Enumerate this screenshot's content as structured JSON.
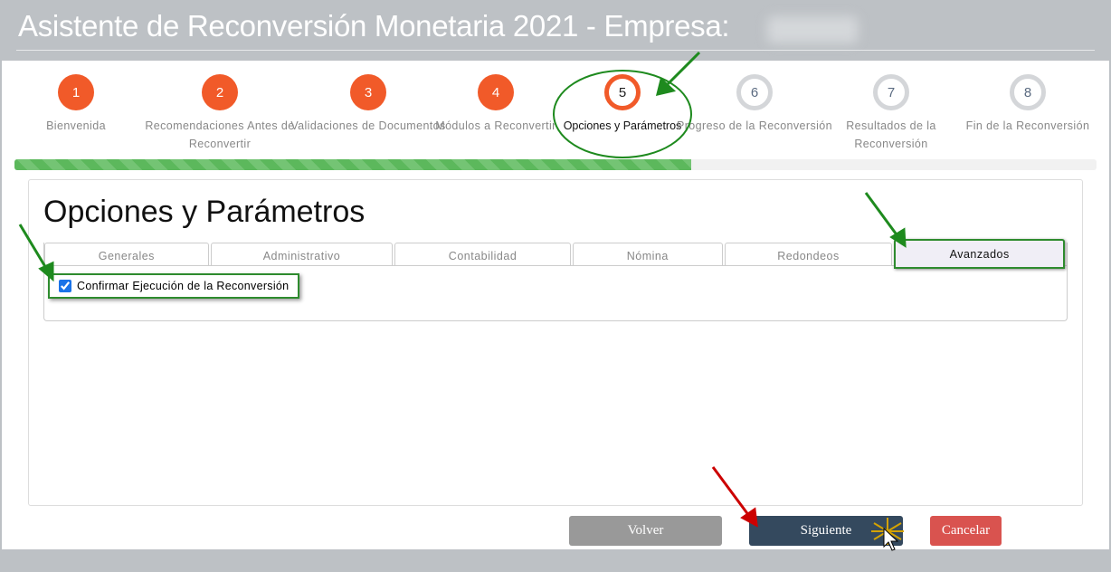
{
  "header": {
    "title": "Asistente de Reconversión Monetaria 2021 - Empresa:"
  },
  "steps": [
    {
      "num": "1",
      "label": "Bienvenida",
      "state": "done"
    },
    {
      "num": "2",
      "label": "Recomendaciones Antes de Reconvertir",
      "state": "done"
    },
    {
      "num": "3",
      "label": "Validaciones de Documentos",
      "state": "done"
    },
    {
      "num": "4",
      "label": "Módulos a Reconvertir",
      "state": "done"
    },
    {
      "num": "5",
      "label": "Opciones y Parámetros",
      "state": "current"
    },
    {
      "num": "6",
      "label": "Progreso de la Reconversión",
      "state": "pending"
    },
    {
      "num": "7",
      "label": "Resultados de la Reconversión",
      "state": "pending"
    },
    {
      "num": "8",
      "label": "Fin de la Reconversión",
      "state": "pending"
    }
  ],
  "progress_percent": 62.5,
  "main": {
    "title": "Opciones y Parámetros",
    "tabs": [
      "Generales",
      "Administrativo",
      "Contabilidad",
      "Nómina",
      "Redondeos",
      "Avanzados"
    ],
    "active_tab": "Avanzados",
    "confirm_checkbox": {
      "label": "Confirmar Ejecución de la Reconversión",
      "checked": true
    }
  },
  "buttons": {
    "back": "Volver",
    "next": "Siguiente",
    "cancel": "Cancelar"
  },
  "colors": {
    "accent": "#f15a29",
    "progress": "#5cb85c",
    "next": "#34495e",
    "cancel": "#d9534f",
    "back": "#999999"
  }
}
